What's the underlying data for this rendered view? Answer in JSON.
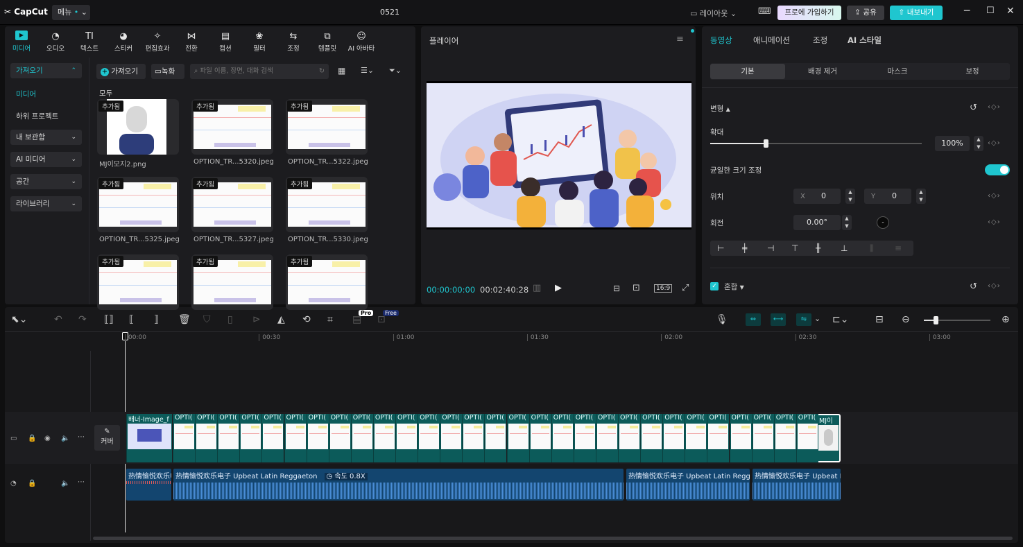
{
  "app": {
    "logo": "CapCut",
    "menu": "메뉴",
    "project_name": "0521",
    "layout": "레이아웃",
    "join_pro": "프로에 가입하기",
    "share": "공유",
    "export": "내보내기"
  },
  "toolbar_tabs": [
    {
      "label": "미디어",
      "icon": "media-icon"
    },
    {
      "label": "오디오",
      "icon": "audio-icon"
    },
    {
      "label": "텍스트",
      "icon": "text-icon"
    },
    {
      "label": "스티커",
      "icon": "sticker-icon"
    },
    {
      "label": "편집효과",
      "icon": "effects-icon"
    },
    {
      "label": "전환",
      "icon": "transition-icon"
    },
    {
      "label": "캡션",
      "icon": "caption-icon"
    },
    {
      "label": "필터",
      "icon": "filter-icon"
    },
    {
      "label": "조정",
      "icon": "adjust-icon"
    },
    {
      "label": "템플릿",
      "icon": "template-icon"
    },
    {
      "label": "AI 아바타",
      "icon": "avatar-icon"
    }
  ],
  "sidebar": {
    "import": "가져오기",
    "media": "미디어",
    "sub_project": "하위 프로젝트",
    "my_storage": "내 보관함",
    "ai_media": "AI 미디어",
    "space": "공간",
    "library": "라이브러리"
  },
  "media": {
    "import_btn": "가져오기",
    "record_btn": "녹화",
    "search_placeholder": "파일 이름, 장면, 대화 검색",
    "section": "모두",
    "added_badge": "추가됨",
    "items": [
      "MJ이모지2.png",
      "OPTION_TR...5320.jpeg",
      "OPTION_TR...5322.jpeg",
      "OPTION_TR...5325.jpeg",
      "OPTION_TR...5327.jpeg",
      "OPTION_TR...5330.jpeg",
      "",
      "",
      ""
    ]
  },
  "player": {
    "title": "플레이어",
    "current_time": "00:00:00:00",
    "total_time": "00:02:40:28",
    "ratio": "16:9"
  },
  "props": {
    "tabs": [
      "동영상",
      "애니메이션",
      "조정",
      "AI 스타일"
    ],
    "subtabs": [
      "기본",
      "배경 제거",
      "마스크",
      "보정"
    ],
    "transform": "변형",
    "scale_label": "확대",
    "scale_value": "100%",
    "scale_fraction": 1.0,
    "uniform_scale": "균일한 크기 조정",
    "position": "위치",
    "x_label": "X",
    "x_value": "0",
    "y_label": "Y",
    "y_value": "0",
    "rotation": "회전",
    "rotation_value": "0.00°",
    "blend": "혼합"
  },
  "timeline": {
    "pro_badge": "Pro",
    "free_badge": "Free",
    "ruler": [
      "00:00",
      "00:30",
      "01:00",
      "01:30",
      "02:00",
      "02:30",
      "03:00"
    ],
    "cover": "커버",
    "first_clip": "배너-Image_f",
    "clip_label": "OPTI(",
    "last_clip": "MJ이",
    "audio": [
      {
        "label": "热情愉悦欢乐电"
      },
      {
        "label": "热情愉悦欢乐电子  Upbeat Latin Reggaeton",
        "speed": "속도 0.8X"
      },
      {
        "label": "热情愉悦欢乐电子  Upbeat Latin Regga"
      },
      {
        "label": "热情愉悦欢乐电子  Upbeat L"
      }
    ]
  },
  "colors": {
    "accent": "#1fc6cf",
    "audio": "#13456f",
    "video_clip": "#0c5b5a"
  }
}
